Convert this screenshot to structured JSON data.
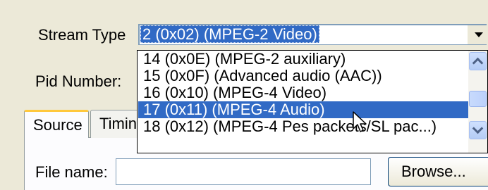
{
  "form": {
    "stream_type_label": "Stream Type",
    "pid_number_label": "Pid Number:",
    "stream_type_value": "2 (0x02) (MPEG-2 Video)"
  },
  "dropdown": {
    "options": [
      "14 (0x0E) (MPEG-2 auxiliary)",
      "15 (0x0F) (Advanced audio (AAC))",
      "16 (0x10) (MPEG-4 Video)",
      "17 (0x11) (MPEG-4 Audio)",
      "18 (0x12) (MPEG-4 Pes packets/SL pac...)"
    ],
    "selected_index": 3
  },
  "tabs": [
    {
      "label": "Source"
    },
    {
      "label": "Timing"
    }
  ],
  "source_panel": {
    "file_name_label": "File name:",
    "file_name_value": "",
    "browse_label": "Browse..."
  },
  "icons": {
    "combo_arrow": "chevron-down-icon",
    "scroll_up": "chevron-up-icon",
    "scroll_down": "chevron-down-icon",
    "cursor": "mouse-pointer-icon"
  },
  "colors": {
    "window_bg": "#ece9d8",
    "selection": "#316ac5",
    "tab_highlight": "#ffc83c"
  }
}
